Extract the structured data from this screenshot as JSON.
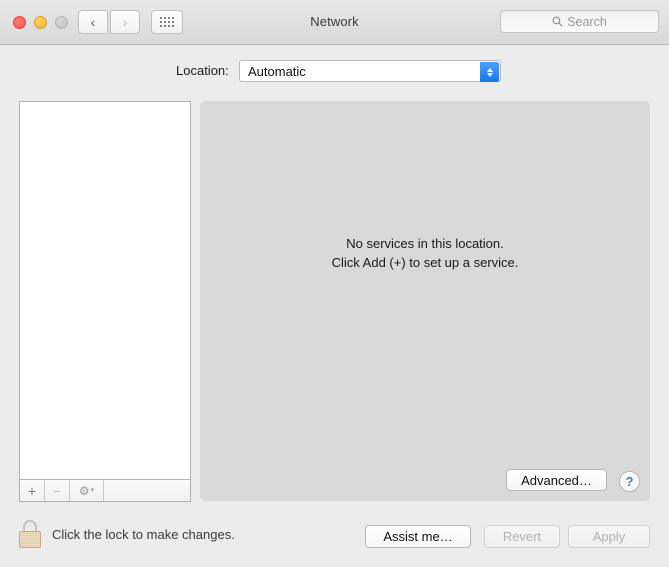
{
  "window": {
    "title": "Network",
    "traffic_lights": [
      {
        "name": "close",
        "color": "#fb5b52"
      },
      {
        "name": "minimize",
        "color": "#f7b32b"
      },
      {
        "name": "zoom",
        "color": "#c2c2c2"
      }
    ],
    "nav": {
      "back_glyph": "‹",
      "forward_glyph": "›"
    },
    "grid_button_icon": "grid-dots-icon",
    "search": {
      "placeholder": "Search",
      "icon": "search-icon"
    }
  },
  "location": {
    "label": "Location:",
    "selected": "Automatic",
    "options": [
      "Automatic"
    ],
    "stepper_color": "#1277e8"
  },
  "services": {
    "items": [],
    "toolbar": {
      "add_label": "+",
      "add_name": "add-service-button",
      "remove_label": "−",
      "remove_name": "remove-service-button",
      "remove_enabled": false,
      "gear_glyph": "⚙",
      "gear_chevron": "▾",
      "gear_name": "action-gear-menu"
    }
  },
  "detail": {
    "empty_title": "No services in this location.",
    "empty_subtitle": "Click Add (+) to set up a service.",
    "advanced_label": "Advanced…",
    "help_label": "?"
  },
  "bottom": {
    "lock_icon": "closed-lock-icon",
    "lock_text": "Click the lock to make changes.",
    "assist_label": "Assist me…",
    "assist_enabled": true,
    "revert_label": "Revert",
    "revert_enabled": false,
    "apply_label": "Apply",
    "apply_enabled": false
  }
}
